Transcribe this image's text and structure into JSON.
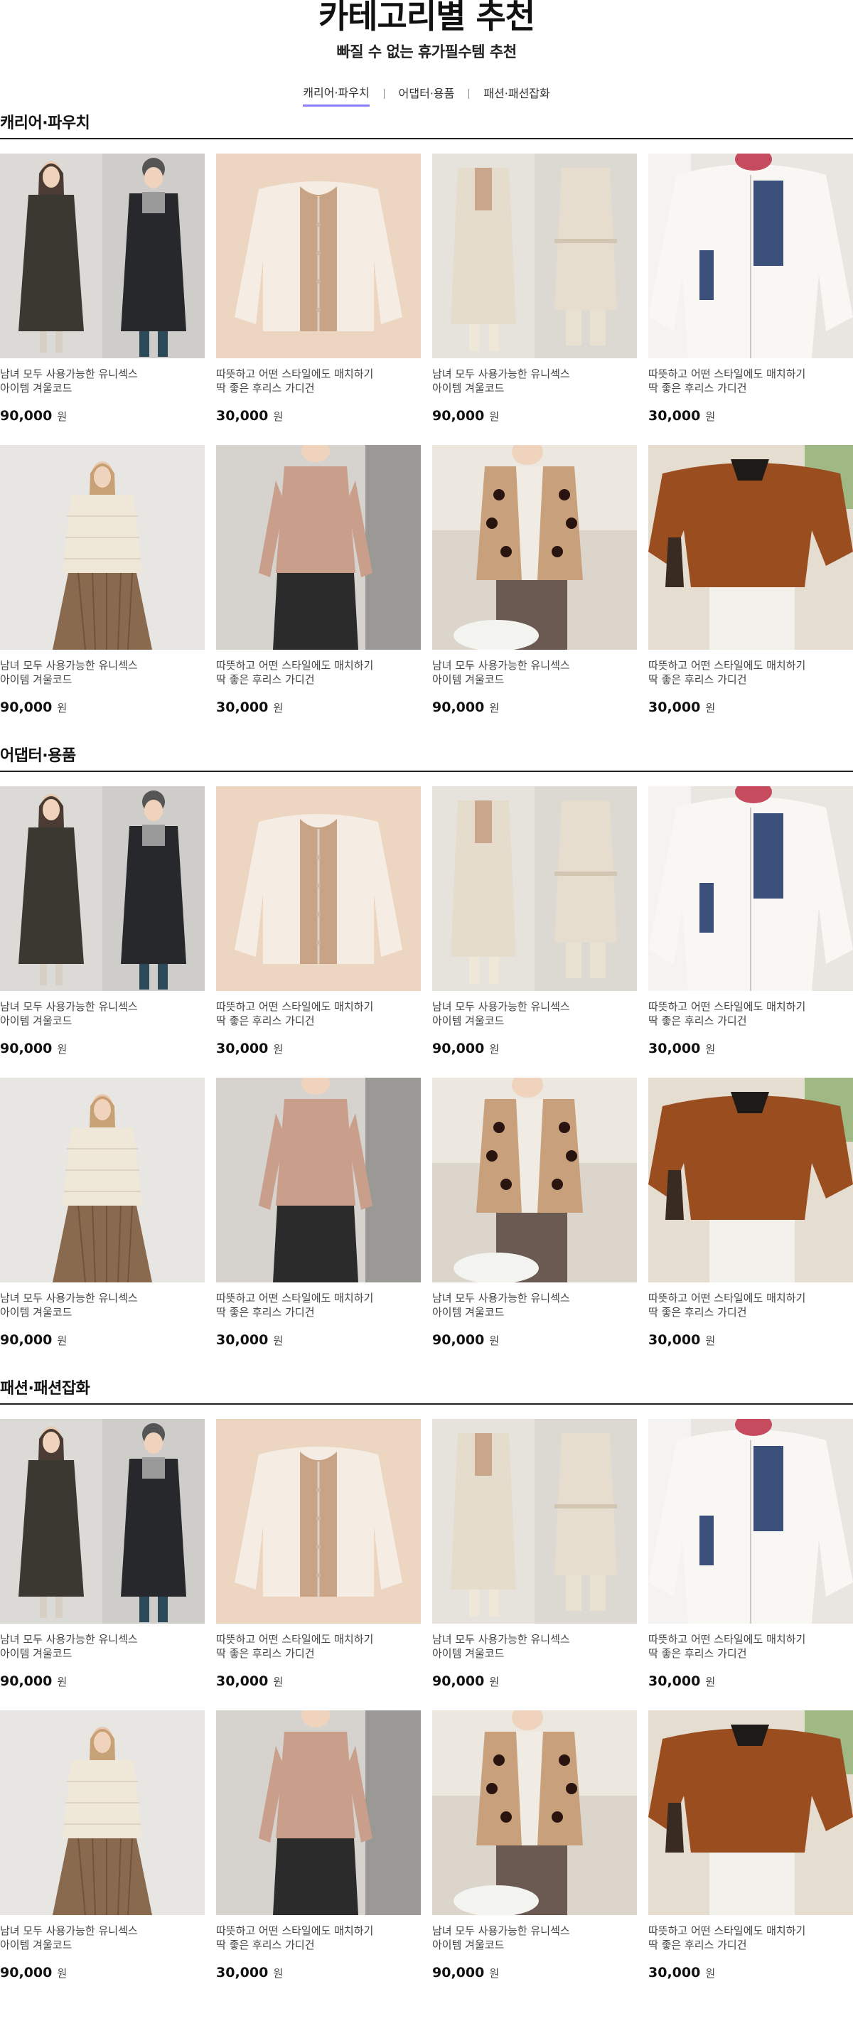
{
  "header": {
    "title": "카테고리별 추천",
    "subtitle": "빠질 수 없는 휴가필수템 추천"
  },
  "tabs": [
    {
      "label": "캐리어·파우치",
      "active": true
    },
    {
      "label": "어댑터·용품",
      "active": false
    },
    {
      "label": "패션·패션잡화",
      "active": false
    }
  ],
  "sections": [
    {
      "title": "캐리어·파우치",
      "products": [
        {
          "desc1": "남녀 모두 사용가능한 유니섹스",
          "desc2": "아이템 겨울코드",
          "price": "90,000",
          "unit": "원",
          "image": "couple-coats"
        },
        {
          "desc1": "따뜻하고 어떤 스타일에도 매치하기",
          "desc2": "딱 좋은 후리스 가디건",
          "price": "30,000",
          "unit": "원",
          "image": "fleece-cardigan"
        },
        {
          "desc1": "남녀 모두 사용가능한 유니섹스",
          "desc2": "아이템 겨울코드",
          "price": "90,000",
          "unit": "원",
          "image": "trench-coats"
        },
        {
          "desc1": "따뜻하고 어떤 스타일에도 매치하기",
          "desc2": "딱 좋은 후리스 가디건",
          "price": "30,000",
          "unit": "원",
          "image": "white-fleece-jacket"
        },
        {
          "desc1": "남녀 모두 사용가능한 유니섹스",
          "desc2": "아이템 겨울코드",
          "price": "90,000",
          "unit": "원",
          "image": "padded-jacket"
        },
        {
          "desc1": "따뜻하고 어떤 스타일에도 매치하기",
          "desc2": "딱 좋은 후리스 가디건",
          "price": "30,000",
          "unit": "원",
          "image": "knit-turtleneck"
        },
        {
          "desc1": "남녀 모두 사용가능한 유니섹스",
          "desc2": "아이템 겨울코드",
          "price": "90,000",
          "unit": "원",
          "image": "polka-cardigan"
        },
        {
          "desc1": "따뜻하고 어떤 스타일에도 매치하기",
          "desc2": "딱 좋은 후리스 가디건",
          "price": "30,000",
          "unit": "원",
          "image": "brown-sweater"
        }
      ]
    },
    {
      "title": "어댑터·용품",
      "products": [
        {
          "desc1": "남녀 모두 사용가능한 유니섹스",
          "desc2": "아이템 겨울코드",
          "price": "90,000",
          "unit": "원",
          "image": "couple-coats"
        },
        {
          "desc1": "따뜻하고 어떤 스타일에도 매치하기",
          "desc2": "딱 좋은 후리스 가디건",
          "price": "30,000",
          "unit": "원",
          "image": "fleece-cardigan"
        },
        {
          "desc1": "남녀 모두 사용가능한 유니섹스",
          "desc2": "아이템 겨울코드",
          "price": "90,000",
          "unit": "원",
          "image": "trench-coats"
        },
        {
          "desc1": "따뜻하고 어떤 스타일에도 매치하기",
          "desc2": "딱 좋은 후리스 가디건",
          "price": "30,000",
          "unit": "원",
          "image": "white-fleece-jacket"
        },
        {
          "desc1": "남녀 모두 사용가능한 유니섹스",
          "desc2": "아이템 겨울코드",
          "price": "90,000",
          "unit": "원",
          "image": "padded-jacket"
        },
        {
          "desc1": "따뜻하고 어떤 스타일에도 매치하기",
          "desc2": "딱 좋은 후리스 가디건",
          "price": "30,000",
          "unit": "원",
          "image": "knit-turtleneck"
        },
        {
          "desc1": "남녀 모두 사용가능한 유니섹스",
          "desc2": "아이템 겨울코드",
          "price": "90,000",
          "unit": "원",
          "image": "polka-cardigan"
        },
        {
          "desc1": "따뜻하고 어떤 스타일에도 매치하기",
          "desc2": "딱 좋은 후리스 가디건",
          "price": "30,000",
          "unit": "원",
          "image": "brown-sweater"
        }
      ]
    },
    {
      "title": "패션·패션잡화",
      "products": [
        {
          "desc1": "남녀 모두 사용가능한 유니섹스",
          "desc2": "아이템 겨울코드",
          "price": "90,000",
          "unit": "원",
          "image": "couple-coats"
        },
        {
          "desc1": "따뜻하고 어떤 스타일에도 매치하기",
          "desc2": "딱 좋은 후리스 가디건",
          "price": "30,000",
          "unit": "원",
          "image": "fleece-cardigan"
        },
        {
          "desc1": "남녀 모두 사용가능한 유니섹스",
          "desc2": "아이템 겨울코드",
          "price": "90,000",
          "unit": "원",
          "image": "trench-coats"
        },
        {
          "desc1": "따뜻하고 어떤 스타일에도 매치하기",
          "desc2": "딱 좋은 후리스 가디건",
          "price": "30,000",
          "unit": "원",
          "image": "white-fleece-jacket"
        },
        {
          "desc1": "남녀 모두 사용가능한 유니섹스",
          "desc2": "아이템 겨울코드",
          "price": "90,000",
          "unit": "원",
          "image": "padded-jacket"
        },
        {
          "desc1": "따뜻하고 어떤 스타일에도 매치하기",
          "desc2": "딱 좋은 후리스 가디건",
          "price": "30,000",
          "unit": "원",
          "image": "knit-turtleneck"
        },
        {
          "desc1": "남녀 모두 사용가능한 유니섹스",
          "desc2": "아이템 겨울코드",
          "price": "90,000",
          "unit": "원",
          "image": "polka-cardigan"
        },
        {
          "desc1": "따뜻하고 어떤 스타일에도 매치하기",
          "desc2": "딱 좋은 후리스 가디건",
          "price": "30,000",
          "unit": "원",
          "image": "brown-sweater"
        }
      ]
    }
  ],
  "colors": {
    "tab_active_underline": "#8a80ff",
    "text_primary": "#111111",
    "text_secondary": "#444444"
  }
}
